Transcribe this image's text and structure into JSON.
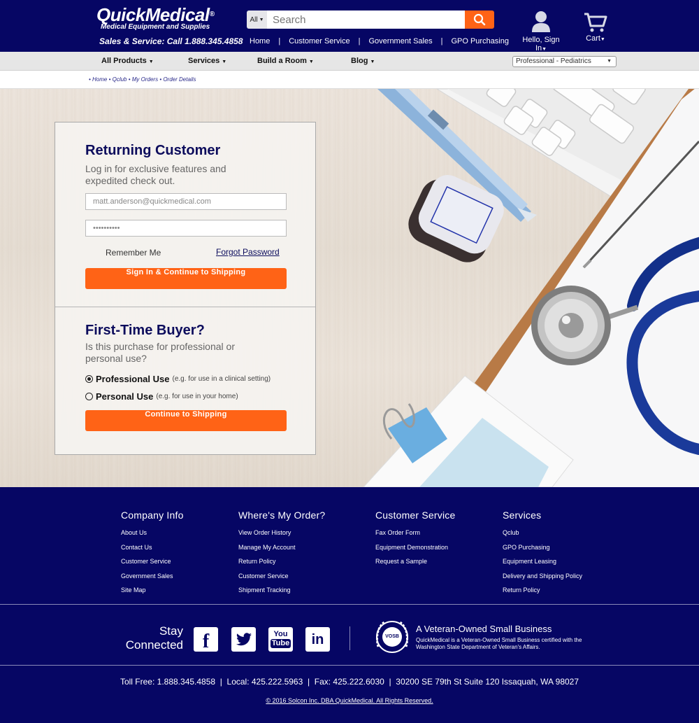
{
  "header": {
    "logo_name": "QuickMedical",
    "logo_reg": "®",
    "logo_tagline": "Medical Equipment and Supplies",
    "phone": "Sales & Service: Call 1.888.345.4858",
    "search": {
      "category": "All",
      "placeholder": "Search"
    },
    "links": [
      "Home",
      "Customer Service",
      "Government Sales",
      "GPO Purchasing"
    ],
    "account_label": "Hello, Sign In",
    "cart_label": "Cart"
  },
  "nav": {
    "items": [
      "All Products",
      "Services",
      "Build a Room",
      "Blog"
    ],
    "profile_select": "Professional - Pediatrics"
  },
  "breadcrumb": "• Home • Qclub • My Orders • Order Details",
  "returning": {
    "title": "Returning Customer",
    "subtitle": "Log in for exclusive features and expedited check out.",
    "email_value": "matt.anderson@quickmedical.com",
    "password_value": "••••••••••",
    "remember_label": "Remember Me",
    "forgot_label": "Forgot Password",
    "signin_label": "Sign In & Continue to Shipping"
  },
  "first_time": {
    "title": "First-Time Buyer?",
    "subtitle": "Is this purchase for professional or personal use?",
    "options": [
      {
        "label": "Professional Use",
        "note": "(e.g. for use in a clinical setting)",
        "selected": true
      },
      {
        "label": "Personal Use",
        "note": "(e.g. for use in your home)",
        "selected": false
      }
    ],
    "continue_label": "Continue to Shipping"
  },
  "footer": {
    "columns": [
      {
        "title": "Company Info",
        "links": [
          "About Us",
          "Contact Us",
          "Customer Service",
          "Government Sales",
          "Site Map"
        ]
      },
      {
        "title": "Where's My Order?",
        "links": [
          "View Order History",
          "Manage My Account",
          "Return Policy",
          "Customer Service",
          "Shipment Tracking"
        ]
      },
      {
        "title": "Customer Service",
        "links": [
          "Fax Order Form",
          "Equipment Demonstration",
          "Request a Sample"
        ]
      },
      {
        "title": "Services",
        "links": [
          "Qclub",
          "GPO Purchasing",
          "Equipment Leasing",
          "Delivery and Shipping Policy",
          "Return Policy"
        ]
      }
    ],
    "stay_line1": "Stay",
    "stay_line2": "Connected",
    "social": [
      "facebook-icon",
      "twitter-icon",
      "youtube-icon",
      "linkedin-icon"
    ],
    "youtube_top": "You",
    "youtube_bottom": "Tube",
    "vosb_badge": "VOSB",
    "vosb_title": "A Veteran-Owned Small Business",
    "vosb_text": "QuickMedical is a Veteran-Owned Small Business certified with the Washington State Department of Veteran's Affairs.",
    "contact": "Toll Free: 1.888.345.4858  |  Local: 425.222.5963  |  Fax: 425.222.6030  |  30200 SE 79th St Suite 120 Issaquah, WA 98027",
    "copyright": "© 2016 Solcon Inc. DBA QuickMedical. All Rights Reserved."
  },
  "colors": {
    "navy": "#060664",
    "accent": "#ff6316",
    "heading": "#0c0c5c"
  }
}
